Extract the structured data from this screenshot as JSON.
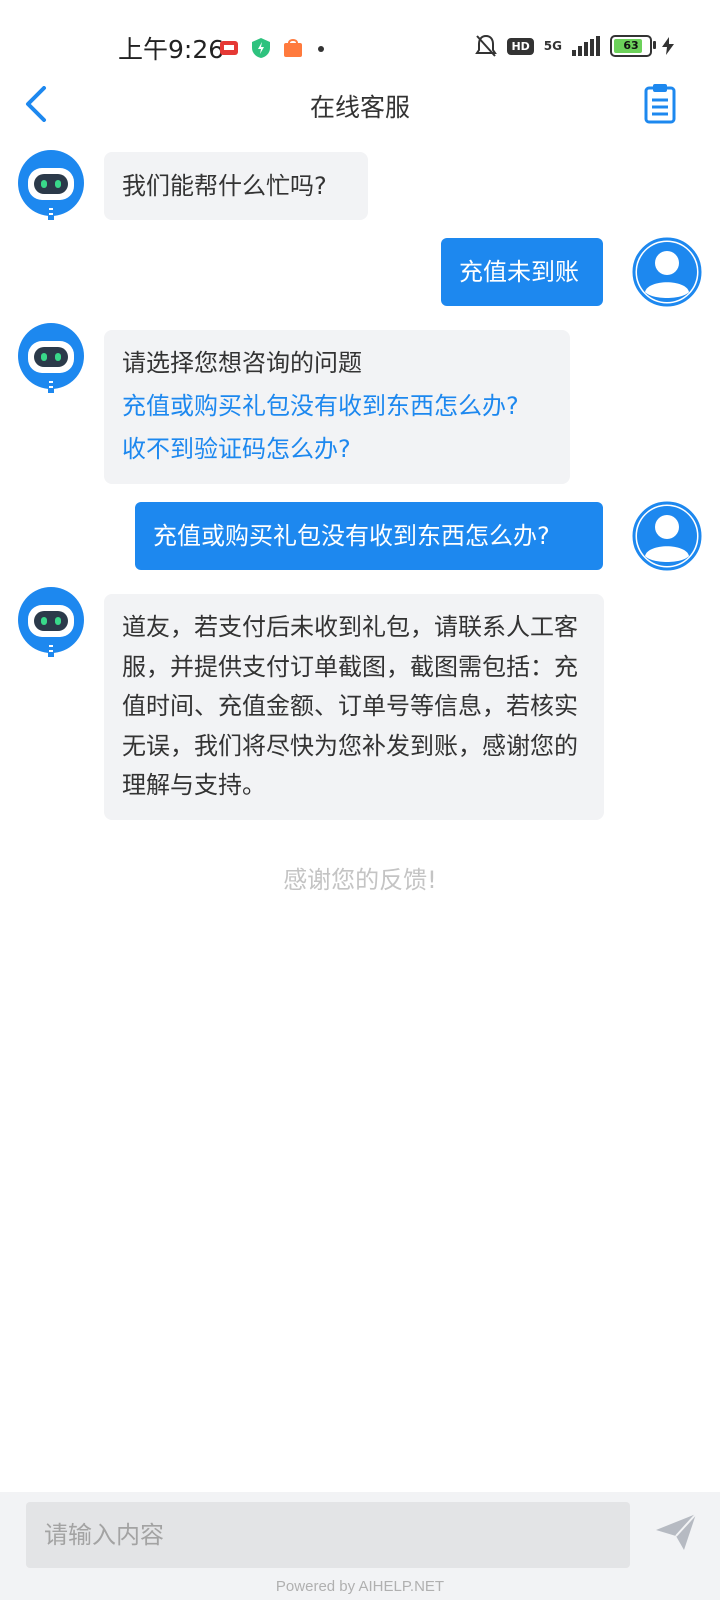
{
  "status_bar": {
    "time": "上午9:26",
    "battery": "63",
    "network": "5G",
    "hd": "HD"
  },
  "header": {
    "title": "在线客服"
  },
  "messages": [
    {
      "from": "bot",
      "text": "我们能帮什么忙吗?"
    },
    {
      "from": "user",
      "text": "充值未到账"
    },
    {
      "from": "bot",
      "intro": "请选择您想咨询的问题",
      "options": [
        "充值或购买礼包没有收到东西怎么办?",
        "收不到验证码怎么办?"
      ]
    },
    {
      "from": "user",
      "text": "充值或购买礼包没有收到东西怎么办?"
    },
    {
      "from": "bot",
      "text": "道友，若支付后未收到礼包，请联系人工客服，并提供支付订单截图，截图需包括：充值时间、充值金额、订单号等信息，若核实无误，我们将尽快为您补发到账，感谢您的理解与支持。"
    }
  ],
  "feedback_text": "感谢您的反馈!",
  "input": {
    "placeholder": "请输入内容"
  },
  "footer": {
    "powered_by": "Powered by AIHELP.NET"
  },
  "colors": {
    "accent": "#1d88ef",
    "bot_bubble": "#f2f3f5",
    "feedback": "#c4c4c4"
  },
  "icons": [
    "back-icon",
    "clipboard-icon",
    "robot-avatar-icon",
    "user-avatar-icon",
    "send-icon"
  ]
}
